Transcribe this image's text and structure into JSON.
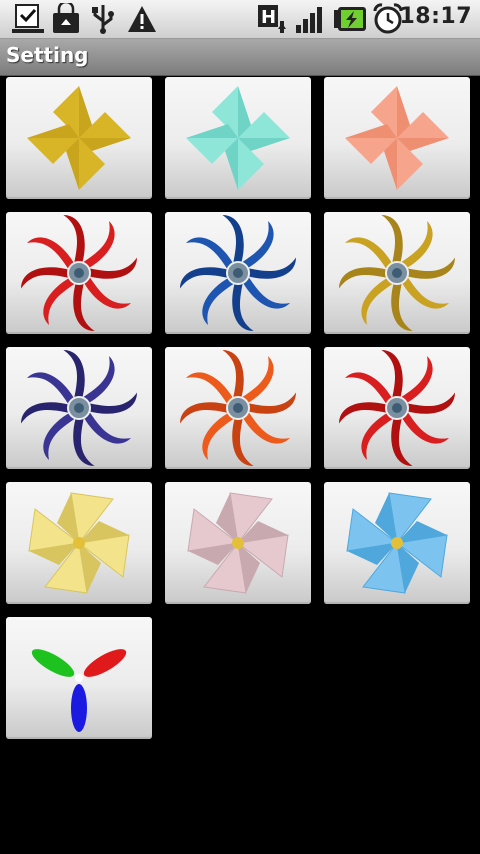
{
  "status_bar": {
    "time": "18:17",
    "icons": [
      "download-done-icon",
      "store-bag-icon",
      "usb-icon",
      "warning-icon",
      "hspa-data-icon",
      "signal-strength-icon",
      "battery-charging-icon",
      "alarm-clock-icon"
    ]
  },
  "title_bar": {
    "title": "Setting"
  },
  "pinwheels": [
    {
      "style": "origami",
      "colors": [
        "#d7b526",
        "#c9a51d"
      ]
    },
    {
      "style": "origami",
      "colors": [
        "#8ee6d9",
        "#6fd3c6"
      ]
    },
    {
      "style": "origami",
      "colors": [
        "#f6a58c",
        "#ee8f72"
      ]
    },
    {
      "style": "curved",
      "colors": [
        "#d81e1e",
        "#b01010"
      ]
    },
    {
      "style": "curved",
      "colors": [
        "#1d55b0",
        "#133f8c"
      ]
    },
    {
      "style": "curved",
      "colors": [
        "#c9a222",
        "#a7851a"
      ]
    },
    {
      "style": "curved",
      "colors": [
        "#3a3593",
        "#28246d"
      ]
    },
    {
      "style": "curved",
      "colors": [
        "#ec5a1c",
        "#c94212"
      ]
    },
    {
      "style": "curved",
      "colors": [
        "#d81e1e",
        "#b01010"
      ]
    },
    {
      "style": "paper",
      "colors": [
        "#f3e38a",
        "#d8c55f"
      ]
    },
    {
      "style": "paper",
      "colors": [
        "#e6c9cf",
        "#c8a9b0"
      ]
    },
    {
      "style": "paper",
      "colors": [
        "#7cc4ef",
        "#4fa7dc"
      ]
    },
    {
      "style": "tri",
      "colors": [
        "#1ec21e",
        "#e01a1a",
        "#1a1ae0"
      ]
    }
  ]
}
